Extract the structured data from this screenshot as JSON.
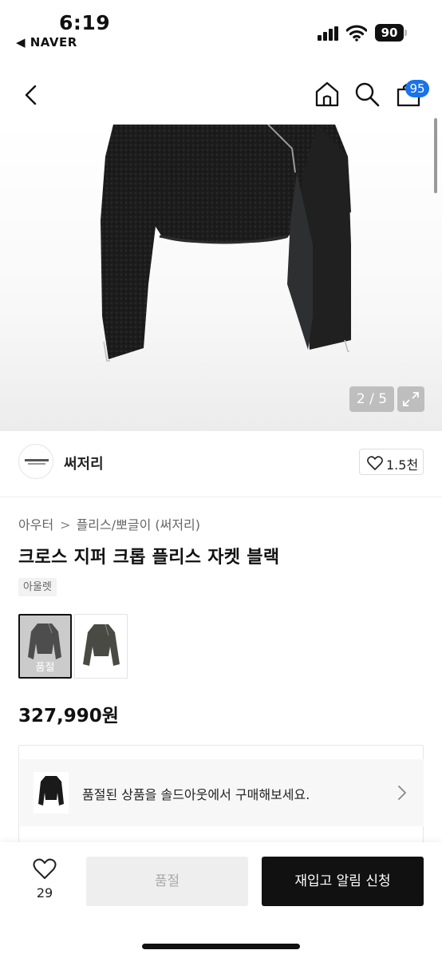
{
  "status_bar": {
    "time": "6:19",
    "back_app": "◀ NAVER",
    "battery": "90"
  },
  "nav": {
    "cart_count": "95"
  },
  "gallery": {
    "pager": "2 / 5"
  },
  "brand": {
    "name": "써저리",
    "likes": "1.5천"
  },
  "product": {
    "breadcrumb": [
      "아우터",
      "플리스/뽀글이 (써저리)"
    ],
    "breadcrumb_separator": ">",
    "title": "크로스 지퍼 크롭 플리스 자켓 블랙",
    "tag": "아울렛",
    "thumbnails": [
      {
        "color": "black",
        "overlay_label": "품절",
        "selected": true
      },
      {
        "color": "khaki",
        "overlay_label": "",
        "selected": false
      }
    ],
    "price": "327,990원"
  },
  "soldout_card": {
    "text": "품절된 상품을 솔드아웃에서 구매해보세요."
  },
  "bottom_bar": {
    "wish_count": "29",
    "soldout_label": "품절",
    "restock_label": "재입고 알림 신청"
  },
  "colors": {
    "accent_badge": "#1a73e8",
    "primary_button": "#111111",
    "disabled_button": "#eeeeee"
  }
}
